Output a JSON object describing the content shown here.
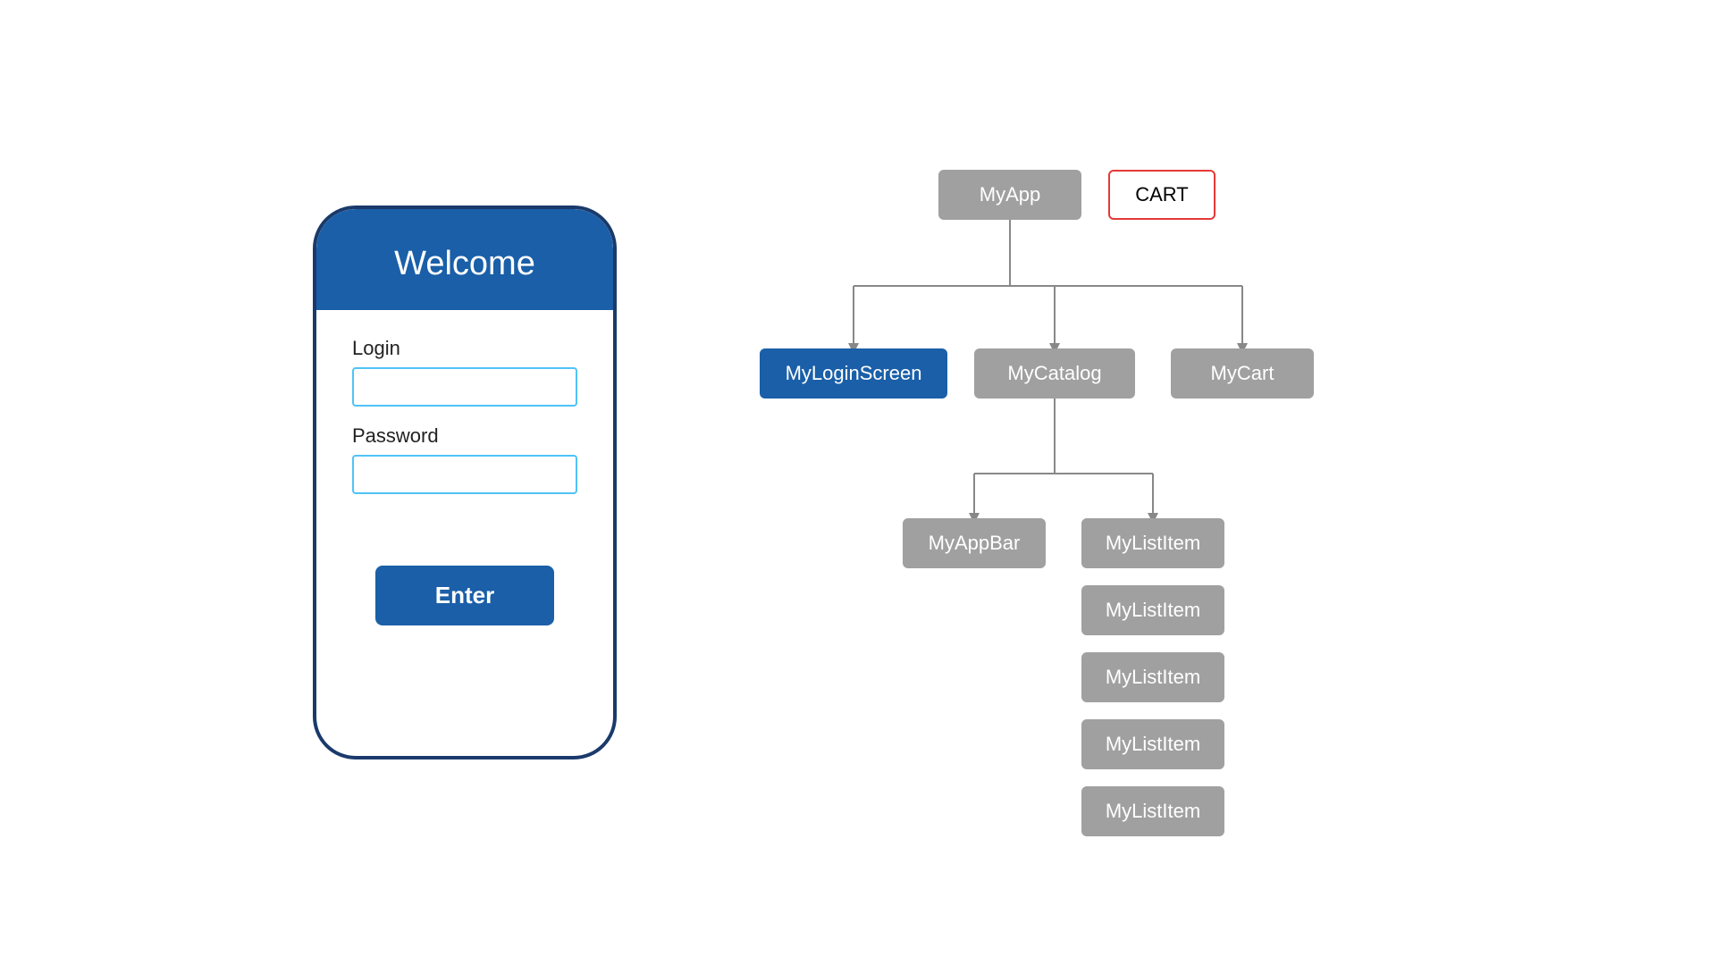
{
  "phone": {
    "title": "Welcome",
    "login_label": "Login",
    "login_placeholder": "",
    "password_label": "Password",
    "password_placeholder": "",
    "enter_button": "Enter"
  },
  "tree": {
    "myapp_label": "MyApp",
    "cart_label": "CART",
    "myloginscreen_label": "MyLoginScreen",
    "mycatalog_label": "MyCatalog",
    "mycart_label": "MyCart",
    "myappbar_label": "MyAppBar",
    "mylistitem_labels": [
      "MyListItem",
      "MyListItem",
      "MyListItem",
      "MyListItem",
      "MyListItem"
    ]
  }
}
